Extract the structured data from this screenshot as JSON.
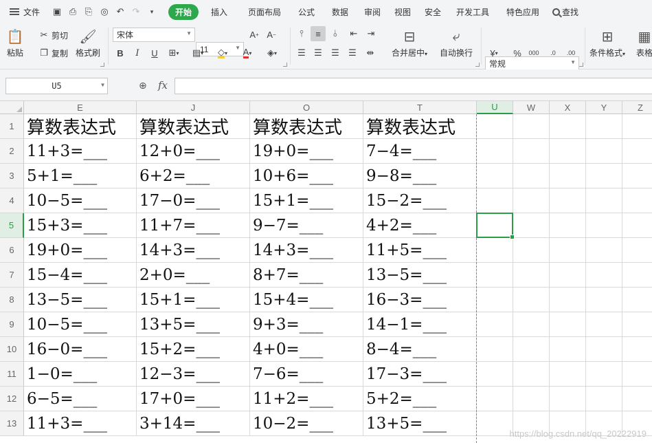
{
  "menubar": {
    "file_label": "文件",
    "tabs": [
      "开始",
      "插入",
      "页面布局",
      "公式",
      "数据",
      "审阅",
      "视图",
      "安全",
      "开发工具",
      "特色应用"
    ],
    "active_tab": "开始",
    "search_label": "查找"
  },
  "ribbon": {
    "paste": "粘贴",
    "cut": "剪切",
    "copy": "复制",
    "format_painter": "格式刷",
    "font_name": "宋体",
    "font_size": "11",
    "merge_center": "合并居中",
    "wrap_text": "自动换行",
    "number_format": "常规",
    "conditional_format": "条件格式",
    "table_style": "表格"
  },
  "formula_bar": {
    "name_box": "U5",
    "fx": "fx",
    "formula": ""
  },
  "sheet": {
    "columns": [
      "E",
      "J",
      "O",
      "T",
      "U",
      "W",
      "X",
      "Y",
      "Z"
    ],
    "selected_column": "U",
    "rows": [
      "1",
      "2",
      "3",
      "4",
      "5",
      "6",
      "7",
      "8",
      "9",
      "10",
      "11",
      "12",
      "13"
    ],
    "selected_row": "5",
    "cells": [
      [
        "算数表达式",
        "算数表达式",
        "算数表达式",
        "算数表达式"
      ],
      [
        "11+3=___",
        "12+0=___",
        "19+0=___",
        "7−4=___"
      ],
      [
        "5+1=___",
        "6+2=___",
        "10+6=___",
        "9−8=___"
      ],
      [
        "10−5=___",
        "17−0=___",
        "15+1=___",
        "15−2=___"
      ],
      [
        "15+3=___",
        "11+7=___",
        "9−7=___",
        "4+2=___"
      ],
      [
        "19+0=___",
        "14+3=___",
        "14+3=___",
        "11+5=___"
      ],
      [
        "15−4=___",
        "2+0=___",
        "8+7=___",
        "13−5=___"
      ],
      [
        "13−5=___",
        "15+1=___",
        "15+4=___",
        "16−3=___"
      ],
      [
        "10−5=___",
        "13+5=___",
        "9+3=___",
        "14−1=___"
      ],
      [
        "16−0=___",
        "15+2=___",
        "4+0=___",
        "8−4=___"
      ],
      [
        "1−0=___",
        "12−3=___",
        "7−6=___",
        "17−3=___"
      ],
      [
        "6−5=___",
        "17+0=___",
        "11+2=___",
        "5+2=___"
      ],
      [
        "11+3=___",
        "3+14=___",
        "10−2=___",
        "13+5=___"
      ]
    ],
    "watermark": "https://blog.csdn.net/qq_20222919"
  },
  "colors": {
    "accent": "#2da84c",
    "selection": "#2a9d46"
  }
}
